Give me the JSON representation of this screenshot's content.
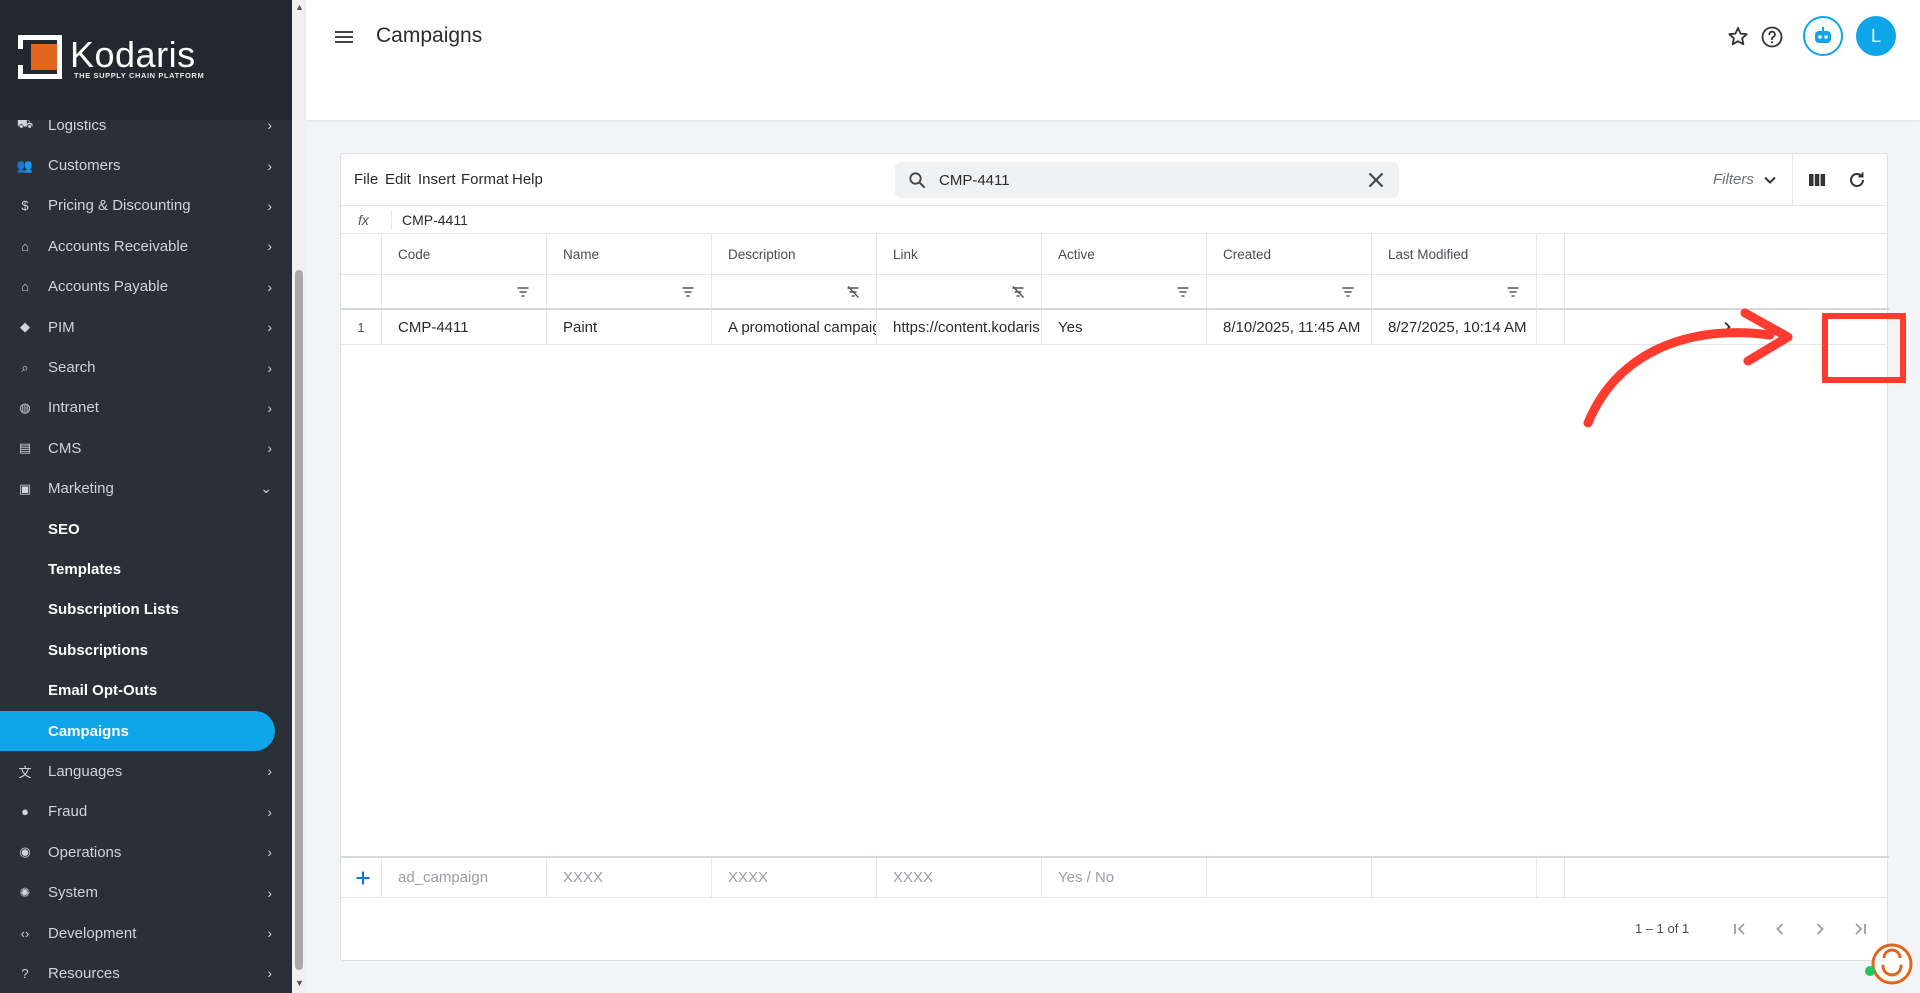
{
  "brand": {
    "name": "Kodaris",
    "tagline": "THE SUPPLY CHAIN PLATFORM"
  },
  "sidebar": {
    "items": [
      {
        "label": "Logistics",
        "icon": "truck-icon"
      },
      {
        "label": "Customers",
        "icon": "people-icon"
      },
      {
        "label": "Pricing & Discounting",
        "icon": "dollar-icon"
      },
      {
        "label": "Accounts Receivable",
        "icon": "bank-icon"
      },
      {
        "label": "Accounts Payable",
        "icon": "bank-icon"
      },
      {
        "label": "PIM",
        "icon": "tag-icon"
      },
      {
        "label": "Search",
        "icon": "search-icon"
      },
      {
        "label": "Intranet",
        "icon": "globe-icon"
      },
      {
        "label": "CMS",
        "icon": "web-icon"
      },
      {
        "label": "Marketing",
        "icon": "campaign-icon",
        "expanded": true
      }
    ],
    "marketing_sub": [
      {
        "label": "SEO"
      },
      {
        "label": "Templates"
      },
      {
        "label": "Subscription Lists"
      },
      {
        "label": "Subscriptions"
      },
      {
        "label": "Email Opt-Outs"
      },
      {
        "label": "Campaigns",
        "active": true
      }
    ],
    "items_after": [
      {
        "label": "Languages",
        "icon": "translate-icon"
      },
      {
        "label": "Fraud",
        "icon": "alert-icon"
      },
      {
        "label": "Operations",
        "icon": "operations-icon"
      },
      {
        "label": "System",
        "icon": "gear-icon"
      },
      {
        "label": "Development",
        "icon": "code-icon"
      },
      {
        "label": "Resources",
        "icon": "help-icon"
      }
    ]
  },
  "header": {
    "title": "Campaigns",
    "avatar_initial": "L"
  },
  "toolbar": {
    "menus": [
      "File",
      "Edit",
      "Insert",
      "Format",
      "Help"
    ],
    "search_value": "CMP-4411",
    "filters_label": "Filters"
  },
  "formula_bar": {
    "label": "fx",
    "value": "CMP-4411"
  },
  "table": {
    "columns": [
      "Code",
      "Name",
      "Description",
      "Link",
      "Active",
      "Created",
      "Last Modified"
    ],
    "rows": [
      {
        "num": "1",
        "cells": [
          "CMP-4411",
          "Paint",
          "A promotional campaig...",
          "https://content.kodaris.c...",
          "Yes",
          "8/10/2025, 11:45 AM",
          "8/27/2025, 10:14 AM"
        ]
      }
    ],
    "new_row_placeholders": [
      "ad_campaign",
      "XXXX",
      "XXXX",
      "XXXX",
      "Yes / No",
      "",
      ""
    ]
  },
  "pager": {
    "text": "1 – 1 of 1"
  },
  "colors": {
    "accent": "#0ea5e9",
    "sidebar_bg": "#2a2f38",
    "annotation": "#ff3b30"
  }
}
